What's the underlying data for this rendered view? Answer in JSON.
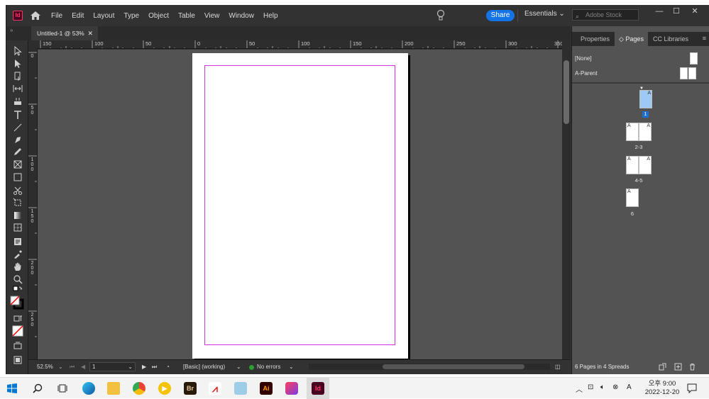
{
  "app": {
    "logo_text": "Id",
    "menu": [
      "File",
      "Edit",
      "Layout",
      "Type",
      "Object",
      "Table",
      "View",
      "Window",
      "Help"
    ],
    "share_label": "Share",
    "workspace": "Essentials",
    "search_placeholder": "Adobe Stock",
    "window_controls": {
      "minimize": "—",
      "maximize": "☐",
      "close": "✕"
    }
  },
  "document": {
    "tab_title": "Untitled-1 @ 53%",
    "tab_close": "✕"
  },
  "rulers": {
    "horizontal": [
      "150",
      "100",
      "50",
      "0",
      "50",
      "100",
      "150",
      "200",
      "250",
      "300",
      "350"
    ],
    "vertical": [
      "0",
      "50",
      "100",
      "150",
      "200",
      "250"
    ]
  },
  "status": {
    "zoom": "52.5%",
    "page": "1",
    "style": "[Basic] (working)",
    "preflight": "No errors"
  },
  "panel": {
    "tabs": [
      "Properties",
      "Pages",
      "CC Libraries"
    ],
    "active_tab": "Pages",
    "masters": [
      "[None]",
      "A-Parent"
    ],
    "page_letter": "A",
    "spreads": [
      {
        "label": "1",
        "selected": true
      },
      {
        "label": "2-3",
        "selected": false
      },
      {
        "label": "4-5",
        "selected": false
      },
      {
        "label": "6",
        "selected": false
      }
    ],
    "summary": "6 Pages in 4 Spreads"
  },
  "taskbar": {
    "apps": [
      "Br",
      "Ai",
      "Id"
    ],
    "time": "오후 9:00",
    "date": "2022-12-20"
  },
  "colors": {
    "accent": "#1473e6",
    "margin_guide": "#d633e0",
    "indesign": "#ff3366",
    "ui_dark": "#323232",
    "pasteboard": "#535353"
  }
}
